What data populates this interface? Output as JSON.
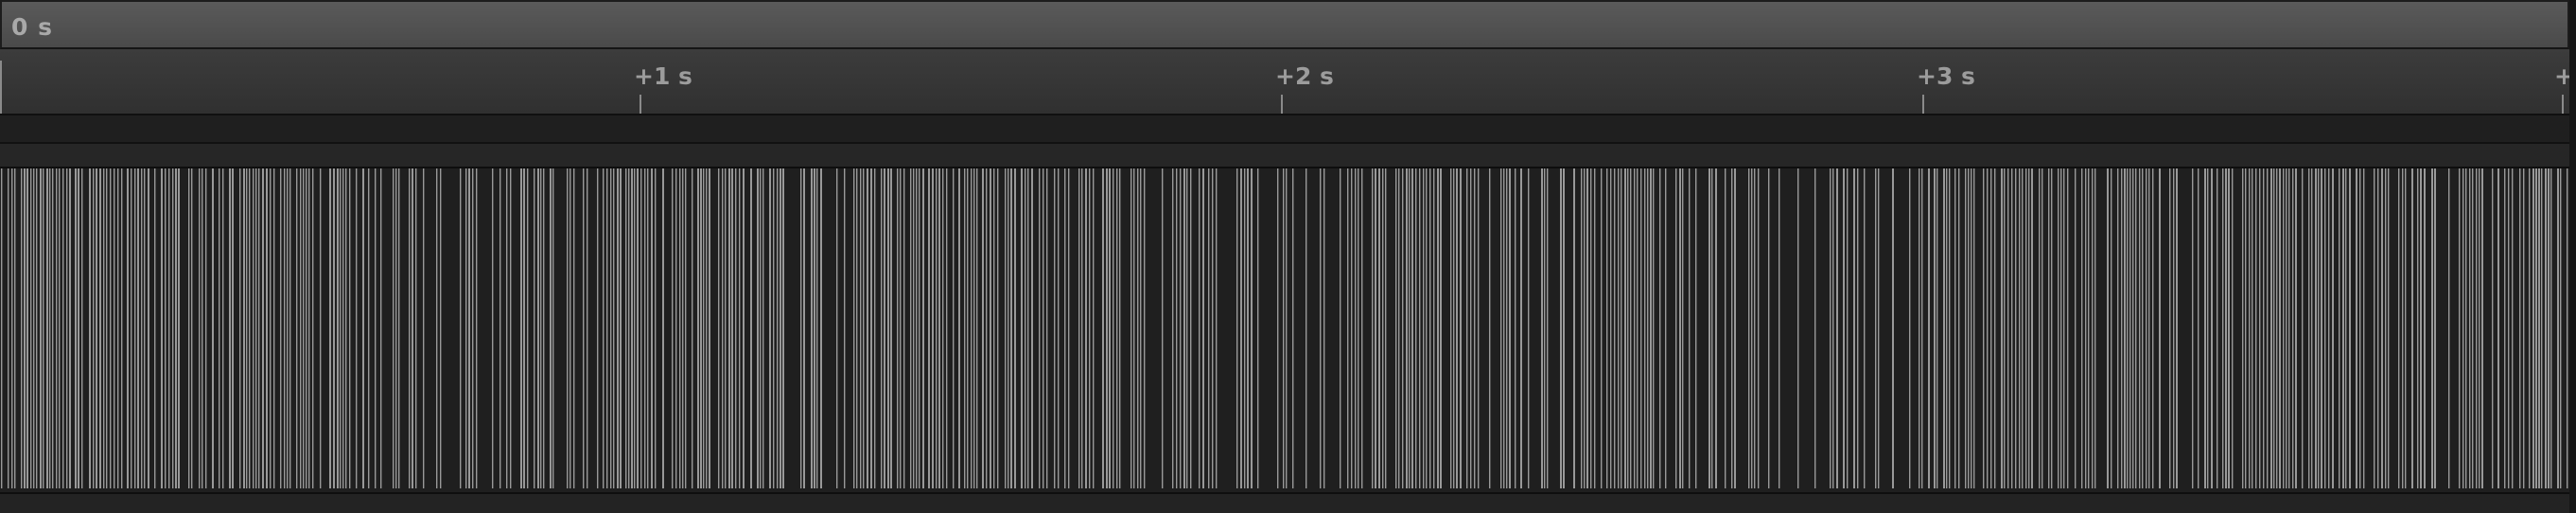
{
  "header": {
    "time_label": "0 s"
  },
  "ruler": {
    "ticks": [
      {
        "label": "+1 s",
        "seconds": 1
      },
      {
        "label": "+2 s",
        "seconds": 2
      },
      {
        "label": "+3 s",
        "seconds": 3
      },
      {
        "label": "+",
        "seconds": 4
      }
    ]
  },
  "colors": {
    "event_mark": "#999999",
    "track_background": "#1f1f1f",
    "header_text": "#a9a9a9"
  }
}
